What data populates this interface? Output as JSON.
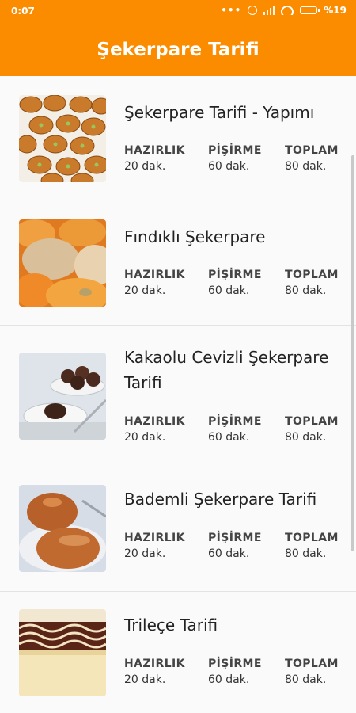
{
  "status_bar": {
    "time": "0:07",
    "dots": "•••",
    "battery": "%19"
  },
  "app_bar": {
    "title": "Şekerpare Tarifi"
  },
  "labels": {
    "prep": "HAZIRLIK",
    "cook": "PİŞİRME",
    "total": "TOPLAM"
  },
  "recipes": [
    {
      "title": "Şekerpare Tarifi - Yapımı",
      "prep": "20 dak.",
      "cook": "60 dak.",
      "total": "80 dak."
    },
    {
      "title": "Fındıklı Şekerpare",
      "prep": "20 dak.",
      "cook": "60 dak.",
      "total": "80 dak."
    },
    {
      "title": "Kakaolu Cevizli Şekerpare Tarifi",
      "prep": "20 dak.",
      "cook": "60 dak.",
      "total": "80 dak."
    },
    {
      "title": "Bademli Şekerpare Tarifi",
      "prep": "20 dak.",
      "cook": "60 dak.",
      "total": "80 dak."
    },
    {
      "title": "Trileçe Tarifi",
      "prep": "20 dak.",
      "cook": "60 dak.",
      "total": "80 dak."
    }
  ],
  "colors": {
    "primary": "#fb8c00"
  }
}
